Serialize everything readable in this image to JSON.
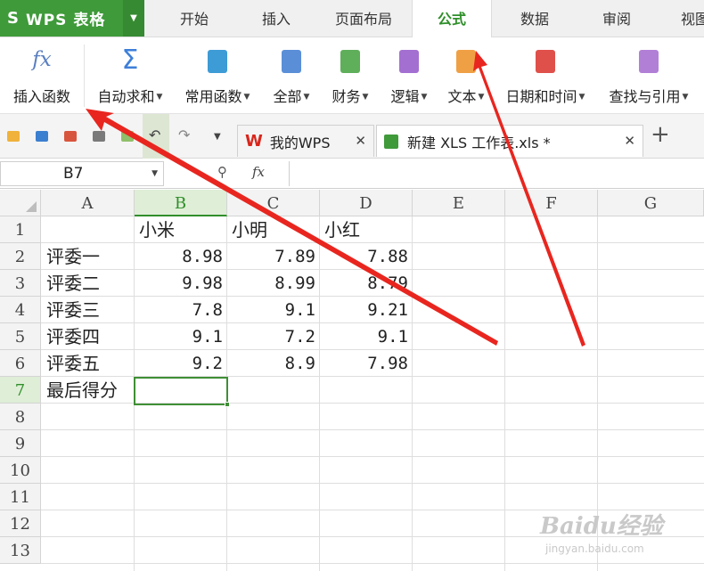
{
  "app": {
    "logo": "S",
    "name": "WPS 表格"
  },
  "menu_tabs": [
    {
      "label": "开始"
    },
    {
      "label": "插入"
    },
    {
      "label": "页面布局"
    },
    {
      "label": "公式",
      "active": true
    },
    {
      "label": "数据"
    },
    {
      "label": "审阅"
    },
    {
      "label": "视图"
    }
  ],
  "ribbon": {
    "insert_function": "插入函数",
    "autosum": "自动求和",
    "common_functions": "常用函数",
    "all": "全部",
    "financial": "财务",
    "logical": "逻辑",
    "text": "文本",
    "datetime": "日期和时间",
    "lookup": "查找与引用",
    "fx_glyph": "fx",
    "sigma_glyph": "Σ"
  },
  "doc_tabs": [
    {
      "label": "我的WPS"
    },
    {
      "label": "新建 XLS 工作表.xls *",
      "active": true
    }
  ],
  "formula_bar": {
    "name_box": "B7",
    "fx_glyph": "fx",
    "formula": ""
  },
  "columns": [
    "A",
    "B",
    "C",
    "D",
    "E",
    "F",
    "G"
  ],
  "rows": [
    "1",
    "2",
    "3",
    "4",
    "5",
    "6",
    "7",
    "8",
    "9",
    "10",
    "11",
    "12",
    "13"
  ],
  "selected": {
    "column": "B",
    "row": "7"
  },
  "cells": {
    "B1": "小米",
    "C1": "小明",
    "D1": "小红",
    "A2": "评委一",
    "B2": "8.98",
    "C2": "7.89",
    "D2": "7.88",
    "A3": "评委二",
    "B3": "9.98",
    "C3": "8.99",
    "D3": "8.79",
    "A4": "评委三",
    "B4": "7.8",
    "C4": "9.1",
    "D4": "9.21",
    "A5": "评委四",
    "B5": "9.1",
    "C5": "7.2",
    "D5": "9.1",
    "A6": "评委五",
    "B6": "9.2",
    "C6": "8.9",
    "D6": "7.98",
    "A7": "最后得分"
  },
  "watermark": {
    "brand": "Baidu经验",
    "url": "jingyan.baidu.com"
  },
  "colors": {
    "accent": "#3f9a3a",
    "arrow": "#e8261f"
  }
}
